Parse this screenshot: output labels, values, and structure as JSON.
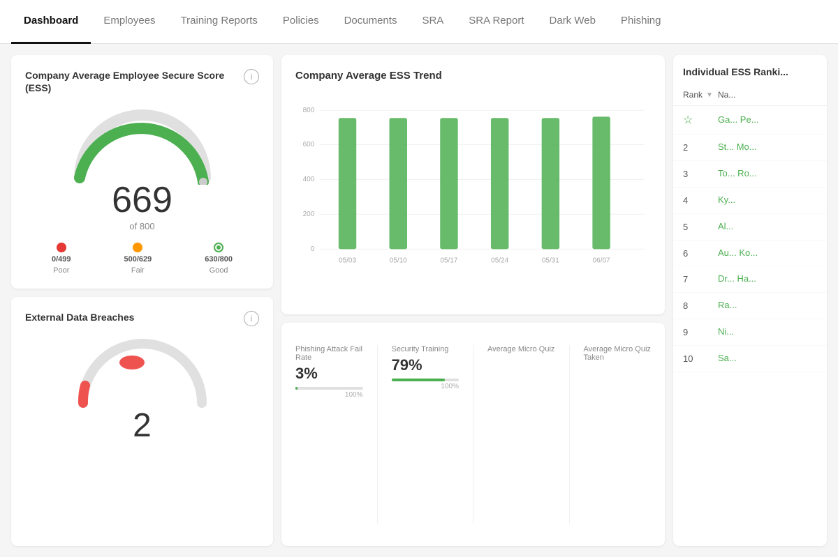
{
  "nav": {
    "items": [
      {
        "label": "Dashboard",
        "active": true
      },
      {
        "label": "Employees",
        "active": false
      },
      {
        "label": "Training Reports",
        "active": false
      },
      {
        "label": "Policies",
        "active": false
      },
      {
        "label": "Documents",
        "active": false
      },
      {
        "label": "SRA",
        "active": false
      },
      {
        "label": "SRA Report",
        "active": false
      },
      {
        "label": "Dark Web",
        "active": false
      },
      {
        "label": "Phishing",
        "active": false
      }
    ]
  },
  "ess_card": {
    "title": "Company Average Employee Secure Score (ESS)",
    "score": "669",
    "of_label": "of 800",
    "legend": [
      {
        "color": "#e53935",
        "range": "0/499",
        "label": "Poor",
        "type": "solid"
      },
      {
        "color": "#ff9800",
        "range": "500/629",
        "label": "Fair",
        "type": "solid"
      },
      {
        "color": "#4caf50",
        "range": "630/800",
        "label": "Good",
        "type": "ring"
      }
    ]
  },
  "breach_card": {
    "title": "External Data Breaches",
    "number": "2"
  },
  "trend_card": {
    "title": "Company Average ESS Trend",
    "y_labels": [
      "800",
      "600",
      "400",
      "200",
      "0"
    ],
    "x_labels": [
      "05/03",
      "05/10",
      "05/17",
      "05/24",
      "05/31",
      "06/07"
    ],
    "bars": [
      680,
      680,
      680,
      680,
      680,
      685
    ]
  },
  "stats_card": {
    "phishing": {
      "label": "Phishing Attack Fail Rate",
      "value": "3%",
      "progress": 3,
      "progress_max": "100%"
    },
    "training": {
      "label": "Security Training",
      "value": "79%",
      "progress": 79,
      "progress_max": "100%"
    },
    "micro_quiz": {
      "label": "Average Micro Quiz"
    },
    "micro_quiz_taken": {
      "label": "Average Micro Quiz Taken"
    }
  },
  "ranking": {
    "title": "Individual ESS Ranki...",
    "rank_label": "Rank",
    "name_label": "Na...",
    "rows": [
      {
        "rank": "★",
        "name": "Ga... Pe...",
        "is_star": true
      },
      {
        "rank": "2",
        "name": "St... Mo...",
        "is_star": false
      },
      {
        "rank": "3",
        "name": "To... Ro...",
        "is_star": false
      },
      {
        "rank": "4",
        "name": "Ky...",
        "is_star": false
      },
      {
        "rank": "5",
        "name": "Al...",
        "is_star": false
      },
      {
        "rank": "6",
        "name": "Au... Ko...",
        "is_star": false
      },
      {
        "rank": "7",
        "name": "Dr... Ha...",
        "is_star": false
      },
      {
        "rank": "8",
        "name": "Ra...",
        "is_star": false
      },
      {
        "rank": "9",
        "name": "Ni...",
        "is_star": false
      },
      {
        "rank": "10",
        "name": "Sa...",
        "is_star": false
      }
    ]
  }
}
